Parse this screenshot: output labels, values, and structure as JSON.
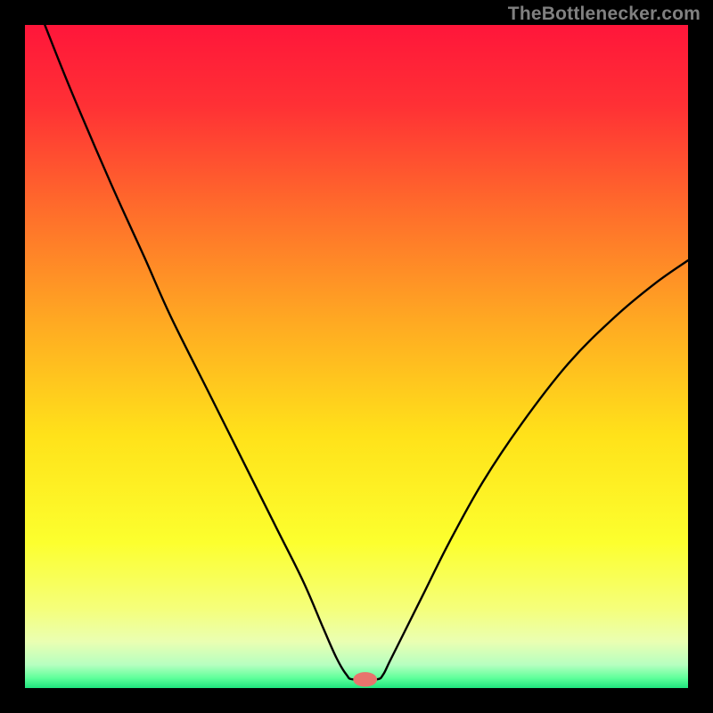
{
  "watermark": "TheBottlenecker.com",
  "chart_data": {
    "type": "line",
    "title": "",
    "xlabel": "",
    "ylabel": "",
    "xlim": [
      0,
      100
    ],
    "ylim": [
      0,
      100
    ],
    "gradient": {
      "stops": [
        {
          "offset": 0.0,
          "color": "#ff163a"
        },
        {
          "offset": 0.12,
          "color": "#ff3035"
        },
        {
          "offset": 0.28,
          "color": "#ff6d2b"
        },
        {
          "offset": 0.45,
          "color": "#ffaa22"
        },
        {
          "offset": 0.62,
          "color": "#ffe21a"
        },
        {
          "offset": 0.78,
          "color": "#fcff2e"
        },
        {
          "offset": 0.88,
          "color": "#f5ff7a"
        },
        {
          "offset": 0.93,
          "color": "#eaffb2"
        },
        {
          "offset": 0.965,
          "color": "#b6ffc0"
        },
        {
          "offset": 0.985,
          "color": "#5eff9a"
        },
        {
          "offset": 1.0,
          "color": "#1fe47e"
        }
      ]
    },
    "series": [
      {
        "name": "bottleneck-curve",
        "color": "#000000",
        "width": 2.4,
        "points": [
          {
            "x": 3.0,
            "y": 100.0
          },
          {
            "x": 7.0,
            "y": 90.0
          },
          {
            "x": 13.0,
            "y": 76.0
          },
          {
            "x": 18.0,
            "y": 65.0
          },
          {
            "x": 22.0,
            "y": 56.0
          },
          {
            "x": 28.0,
            "y": 44.0
          },
          {
            "x": 33.0,
            "y": 34.0
          },
          {
            "x": 38.0,
            "y": 24.0
          },
          {
            "x": 42.0,
            "y": 16.0
          },
          {
            "x": 45.0,
            "y": 9.0
          },
          {
            "x": 47.0,
            "y": 4.5
          },
          {
            "x": 48.5,
            "y": 2.0
          },
          {
            "x": 49.5,
            "y": 1.3
          },
          {
            "x": 53.0,
            "y": 1.3
          },
          {
            "x": 54.0,
            "y": 2.0
          },
          {
            "x": 55.0,
            "y": 4.0
          },
          {
            "x": 57.0,
            "y": 8.0
          },
          {
            "x": 60.0,
            "y": 14.0
          },
          {
            "x": 64.0,
            "y": 22.0
          },
          {
            "x": 69.0,
            "y": 31.0
          },
          {
            "x": 75.0,
            "y": 40.0
          },
          {
            "x": 82.0,
            "y": 49.0
          },
          {
            "x": 89.0,
            "y": 56.0
          },
          {
            "x": 95.0,
            "y": 61.0
          },
          {
            "x": 100.0,
            "y": 64.5
          }
        ]
      }
    ],
    "marker": {
      "x": 51.3,
      "y": 1.3,
      "rx": 1.8,
      "ry": 1.1,
      "fill": "#e8746d"
    }
  }
}
